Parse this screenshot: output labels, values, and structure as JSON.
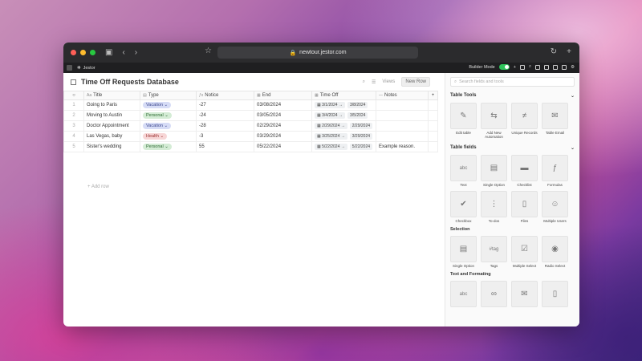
{
  "browser": {
    "url": "newtour.jestor.com"
  },
  "appbar": {
    "brand": "Jestor",
    "builder_mode_label": "Builder Mode"
  },
  "db": {
    "title": "Time Off Requests Database",
    "views_label": "Views",
    "new_row_label": "New Row",
    "add_row_label": "+ Add row",
    "columns": [
      "Title",
      "Type",
      "Notice",
      "End",
      "Time Off",
      "Notes"
    ],
    "rows": [
      {
        "num": "1",
        "title": "Going to Paris",
        "type": "Vacation",
        "type_kind": "vac",
        "notice": "-27",
        "end": "03/08/2024",
        "start_range": "3/1/2024",
        "end_range": "3/8/2024",
        "notes": ""
      },
      {
        "num": "2",
        "title": "Moving to Austin",
        "type": "Personal",
        "type_kind": "per",
        "notice": "-24",
        "end": "03/05/2024",
        "start_range": "3/4/2024",
        "end_range": "3/5/2024",
        "notes": ""
      },
      {
        "num": "3",
        "title": "Doctor Appointment",
        "type": "Vacation",
        "type_kind": "vac",
        "notice": "-28",
        "end": "02/29/2024",
        "start_range": "2/29/2024",
        "end_range": "2/29/2024",
        "notes": ""
      },
      {
        "num": "4",
        "title": "Las Vegas, baby",
        "type": "Health",
        "type_kind": "hea",
        "notice": "-3",
        "end": "03/29/2024",
        "start_range": "3/25/2024",
        "end_range": "3/29/2024",
        "notes": ""
      },
      {
        "num": "5",
        "title": "Sister's wedding",
        "type": "Personal",
        "type_kind": "per",
        "notice": "55",
        "end": "05/22/2024",
        "start_range": "5/22/2024",
        "end_range": "5/22/2024",
        "notes": "Example reason."
      }
    ]
  },
  "panel": {
    "search_placeholder": "Search fields and tools",
    "table_tools_title": "Table Tools",
    "table_tools": [
      "Edit table",
      "Add New Automation",
      "Unique Records",
      "Table Email"
    ],
    "table_fields_title": "Table fields",
    "table_fields": [
      "Text",
      "Single Option",
      "Checklist",
      "Formulas",
      "Checkbox",
      "To-dos",
      "Files",
      "Multiple Users"
    ],
    "selection_title": "Selection",
    "selection": [
      "Single Option",
      "Tags",
      "Multiple Select",
      "Radio Select"
    ],
    "text_formatting_title": "Text and Formating"
  }
}
